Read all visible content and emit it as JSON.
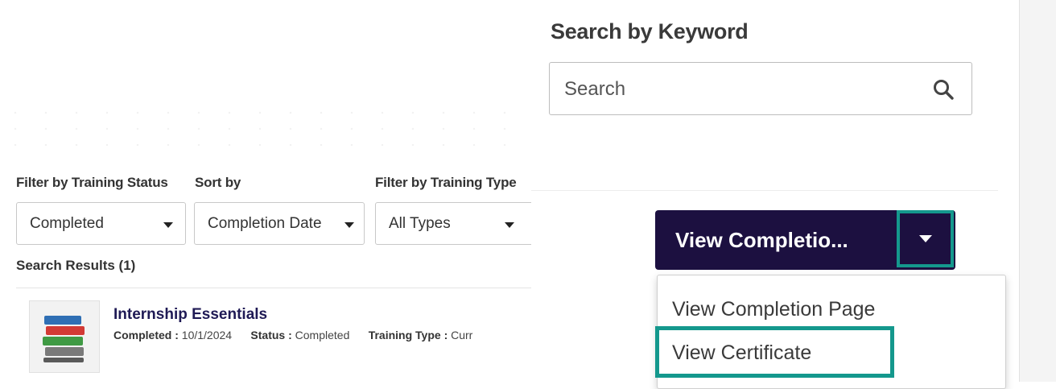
{
  "keyword": {
    "title": "Search by Keyword",
    "placeholder": "Search"
  },
  "filters": {
    "status": {
      "label": "Filter by Training Status",
      "value": "Completed"
    },
    "sort": {
      "label": "Sort by",
      "value": "Completion Date"
    },
    "type": {
      "label": "Filter by Training Type",
      "value": "All Types"
    }
  },
  "results": {
    "label": "Search Results (1)",
    "items": [
      {
        "title": "Internship Essentials",
        "completed_label": "Completed :",
        "completed_value": "10/1/2024",
        "status_label": "Status :",
        "status_value": "Completed",
        "type_label": "Training Type :",
        "type_value": "Curr"
      }
    ]
  },
  "action_button": {
    "label": "View Completio..."
  },
  "menu": {
    "items": [
      "View Completion Page",
      "View Certificate"
    ]
  },
  "colors": {
    "button_bg": "#1c1040",
    "highlight": "#14988d",
    "title": "#1f1a55"
  }
}
